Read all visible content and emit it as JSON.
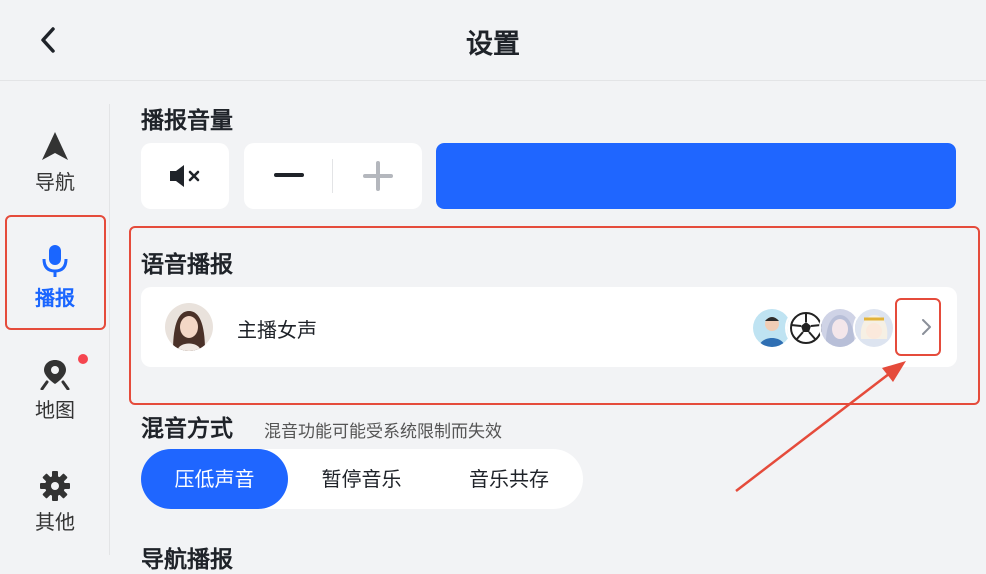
{
  "header": {
    "title": "设置"
  },
  "sidebar": {
    "items": [
      {
        "label": "导航",
        "icon": "navigation-arrow-icon"
      },
      {
        "label": "播报",
        "icon": "microphone-icon",
        "active": true
      },
      {
        "label": "地图",
        "icon": "map-pin-icon",
        "badge_dot": true
      },
      {
        "label": "其他",
        "icon": "gear-icon"
      }
    ]
  },
  "volume": {
    "title": "播报音量",
    "level_percent": 100
  },
  "voice": {
    "title": "语音播报",
    "selected_voice": "主播女声"
  },
  "mix": {
    "title": "混音方式",
    "hint": "混音功能可能受系统限制而失效",
    "options": [
      "压低声音",
      "暂停音乐",
      "音乐共存"
    ],
    "selected_index": 0
  },
  "next_section_title": "导航播报",
  "colors": {
    "accent": "#1f66ff",
    "highlight": "#e54b3b",
    "badge": "#f5454f"
  }
}
